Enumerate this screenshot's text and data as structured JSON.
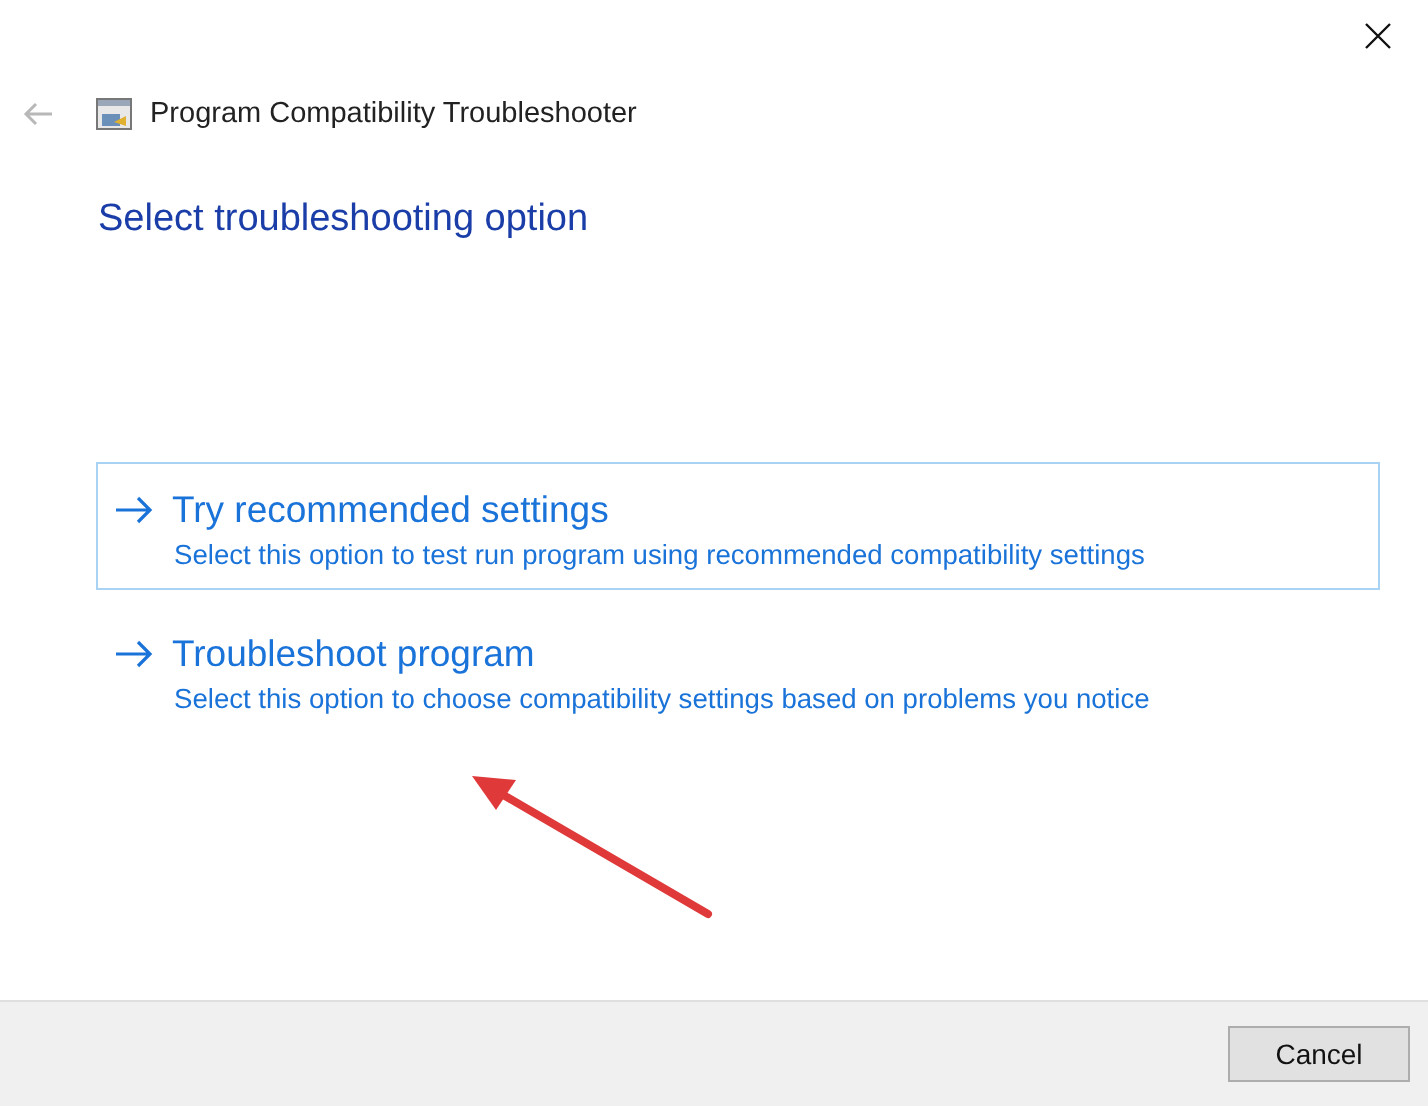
{
  "window": {
    "title": "Program Compatibility Troubleshooter"
  },
  "heading": "Select troubleshooting option",
  "options": [
    {
      "title": "Try recommended settings",
      "description": "Select this option to test run program using recommended compatibility settings",
      "selected": true
    },
    {
      "title": "Troubleshoot program",
      "description": "Select this option to choose compatibility settings based on problems you notice",
      "selected": false
    }
  ],
  "buttons": [
    "Cancel"
  ]
}
